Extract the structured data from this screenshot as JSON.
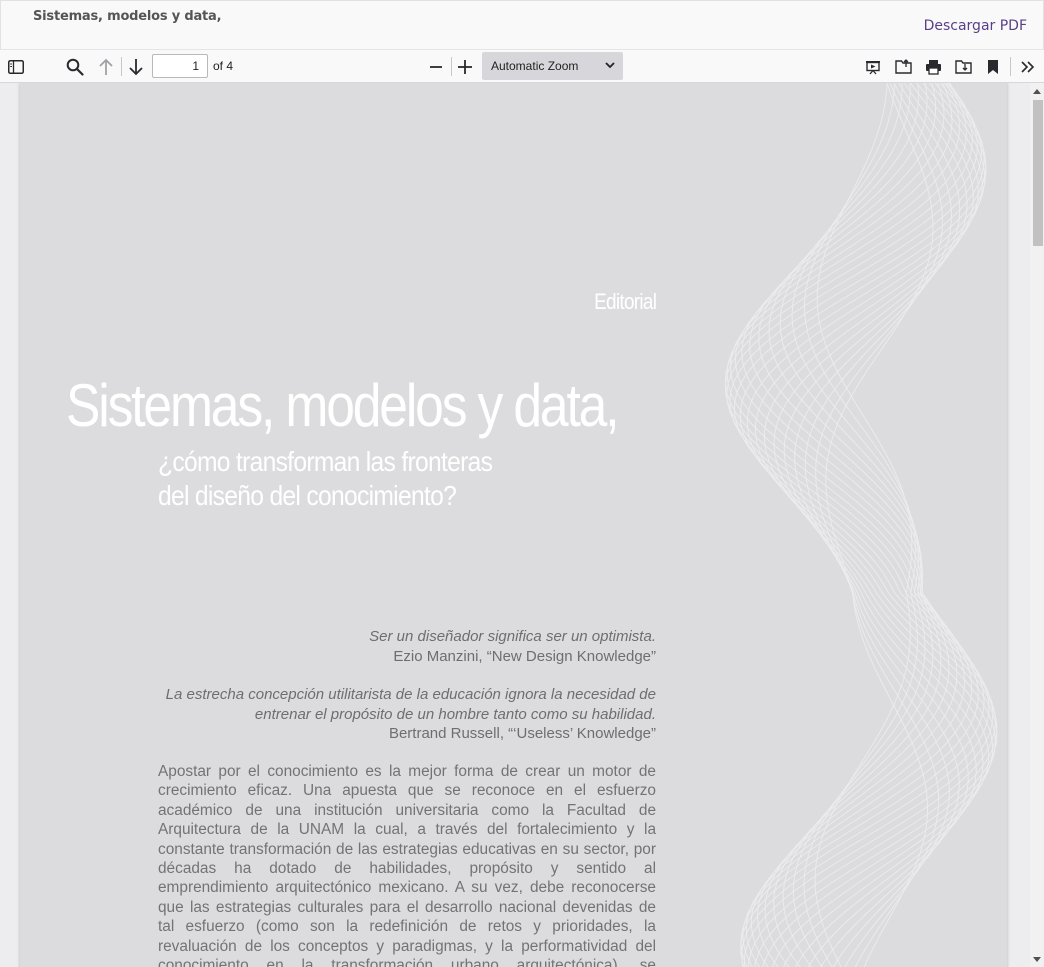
{
  "header": {
    "title": "Sistemas, modelos y data,",
    "download_label": "Descargar PDF"
  },
  "toolbar": {
    "page_number": "1",
    "page_count_label": "of 4",
    "zoom_label": "Automatic Zoom",
    "icons": [
      "sidebar-toggle-icon",
      "search-icon",
      "previous-page-icon",
      "next-page-icon",
      "zoom-out-icon",
      "zoom-in-icon",
      "presentation-mode-icon",
      "open-file-icon",
      "print-icon",
      "download-icon",
      "bookmark-icon",
      "tools-menu-icon"
    ]
  },
  "document": {
    "section": "Editorial",
    "title": "Sistemas, modelos y data,",
    "subtitle_line1": "¿cómo transforman las fronteras",
    "subtitle_line2": "del diseño del conocimiento?",
    "quote1_text": "Ser un diseñador significa ser un optimista.",
    "quote1_author": "Ezio Manzini, “New Design Knowledge”",
    "quote2_text_line1": "La estrecha concepción utilitarista de la educación ignora la necesidad de",
    "quote2_text_line2": "entrenar el propósito de un hombre tanto como su habilidad.",
    "quote2_author": "Bertrand Russell, “‘Useless’ Knowledge”",
    "body": "Apostar por el conocimiento es la mejor forma de crear un motor de crecimiento eficaz. Una apuesta que se reconoce en el esfuerzo académico de una institución universitaria como la Facultad de Arquitectura de la UNAM la cual, a través del fortalecimiento y la constante transformación de las estrategias educativas en su sector, por décadas ha dotado de habilidades, propósito y sentido al emprendimiento arquitectónico mexicano. A su vez, debe reconocerse que las estrategias culturales para el desarrollo nacional devenidas de tal esfuerzo (como son la redefinición de retos y prioridades, la revaluación de los conceptos y paradigmas, y la performatividad del conocimiento en la transformación urbano arquitectónica), se consolidan, legitiman y reconfiguran en"
  },
  "colors": {
    "page_background": "#dcdcde",
    "title_color": "#ffffff",
    "body_text": "#737377",
    "link_color": "#5b3f86"
  }
}
